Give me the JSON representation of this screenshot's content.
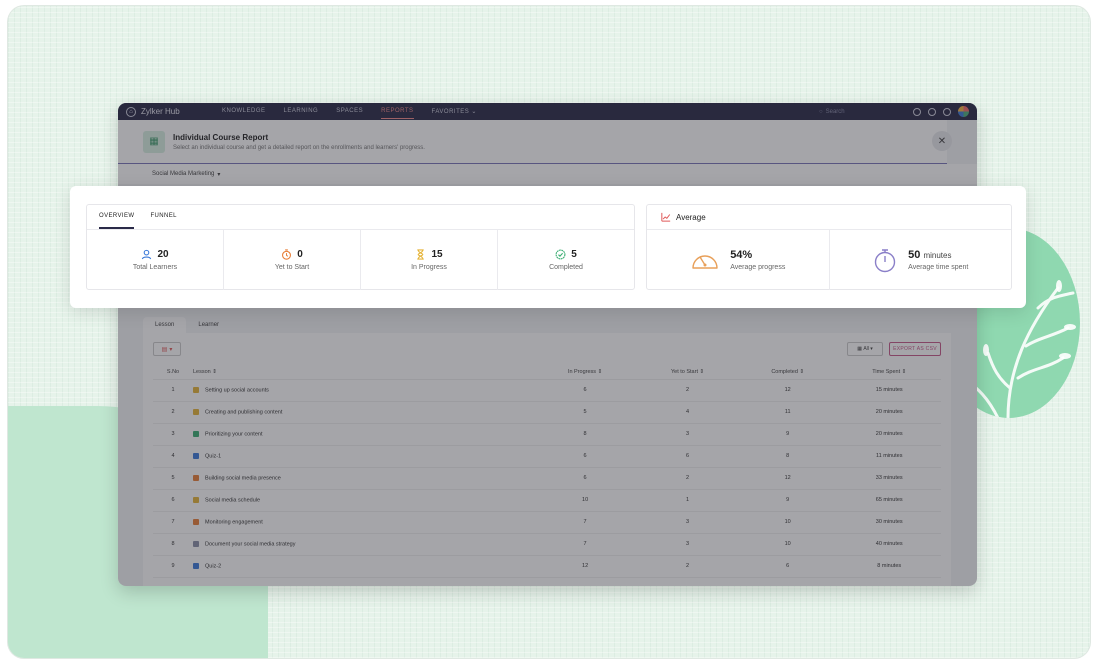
{
  "app": {
    "brand": "Zylker Hub",
    "nav": [
      {
        "label": "KNOWLEDGE"
      },
      {
        "label": "LEARNING"
      },
      {
        "label": "SPACES"
      },
      {
        "label": "REPORTS"
      },
      {
        "label": "FAVORITES ⌄"
      }
    ],
    "search_placeholder": "Search"
  },
  "report": {
    "title": "Individual Course Report",
    "subtitle": "Select an individual course and get a detailed report on the enrollments and learners' progress.",
    "course": "Social Media Marketing",
    "close_glyph": "✕"
  },
  "overview": {
    "tabs": [
      "OVERVIEW",
      "FUNNEL"
    ],
    "stats": [
      {
        "value": "20",
        "label": "Total Learners",
        "icon": "users-icon",
        "color": "#3d7bd9"
      },
      {
        "value": "0",
        "label": "Yet to Start",
        "icon": "timer-icon",
        "color": "#e8803a"
      },
      {
        "value": "15",
        "label": "In Progress",
        "icon": "hourglass-icon",
        "color": "#e6b53a"
      },
      {
        "value": "5",
        "label": "Completed",
        "icon": "badge-check-icon",
        "color": "#3cae74"
      }
    ]
  },
  "average": {
    "title": "Average",
    "stats": [
      {
        "value": "54%",
        "unit": "",
        "label": "Average progress",
        "icon": "gauge-icon"
      },
      {
        "value": "50",
        "unit": "minutes",
        "label": "Average time spent",
        "icon": "stopwatch-icon"
      }
    ]
  },
  "lower": {
    "tabs": [
      "Lesson",
      "Learner"
    ],
    "filter_label": "All",
    "export_label": "EXPORT AS CSV",
    "columns": [
      "S.No",
      "Lesson ⇕",
      "In Progress ⇕",
      "Yet to Start ⇕",
      "Completed ⇕",
      "Time Spent ⇕"
    ],
    "rows": [
      {
        "sno": "1",
        "lesson": "Setting up social accounts",
        "in_progress": "6",
        "yet": "2",
        "completed": "12",
        "time": "15 minutes",
        "icon": "#e6b53a"
      },
      {
        "sno": "2",
        "lesson": "Creating and publishing content",
        "in_progress": "5",
        "yet": "4",
        "completed": "11",
        "time": "20 minutes",
        "icon": "#e6b53a"
      },
      {
        "sno": "3",
        "lesson": "Prioritizing your content",
        "in_progress": "8",
        "yet": "3",
        "completed": "9",
        "time": "20 minutes",
        "icon": "#3cae74"
      },
      {
        "sno": "4",
        "lesson": "Quiz-1",
        "in_progress": "6",
        "yet": "6",
        "completed": "8",
        "time": "11 minutes",
        "icon": "#3d7bd9"
      },
      {
        "sno": "5",
        "lesson": "Building social media presence",
        "in_progress": "6",
        "yet": "2",
        "completed": "12",
        "time": "33 minutes",
        "icon": "#e8803a"
      },
      {
        "sno": "6",
        "lesson": "Social media schedule",
        "in_progress": "10",
        "yet": "1",
        "completed": "9",
        "time": "65 minutes",
        "icon": "#e6b53a"
      },
      {
        "sno": "7",
        "lesson": "Monitoring engagement",
        "in_progress": "7",
        "yet": "3",
        "completed": "10",
        "time": "30 minutes",
        "icon": "#e8803a"
      },
      {
        "sno": "8",
        "lesson": "Document your social media strategy",
        "in_progress": "7",
        "yet": "3",
        "completed": "10",
        "time": "40 minutes",
        "icon": "#8a8fa8"
      },
      {
        "sno": "9",
        "lesson": "Quiz-2",
        "in_progress": "12",
        "yet": "2",
        "completed": "6",
        "time": "8 minutes",
        "icon": "#3d7bd9"
      }
    ]
  }
}
